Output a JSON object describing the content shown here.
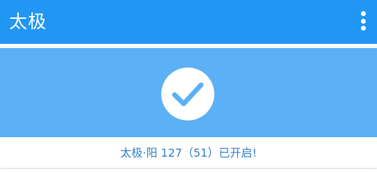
{
  "appbar": {
    "title": "太极",
    "menu_icon": "more-vert-icon"
  },
  "status": {
    "icon": "check-circle-icon",
    "text": "太极·阳 127（51）已开启!"
  },
  "colors": {
    "appbar": "#2196f3",
    "status_background": "#5cb0f5",
    "status_text": "#2f7ec9",
    "check": "#5cb0f5"
  }
}
